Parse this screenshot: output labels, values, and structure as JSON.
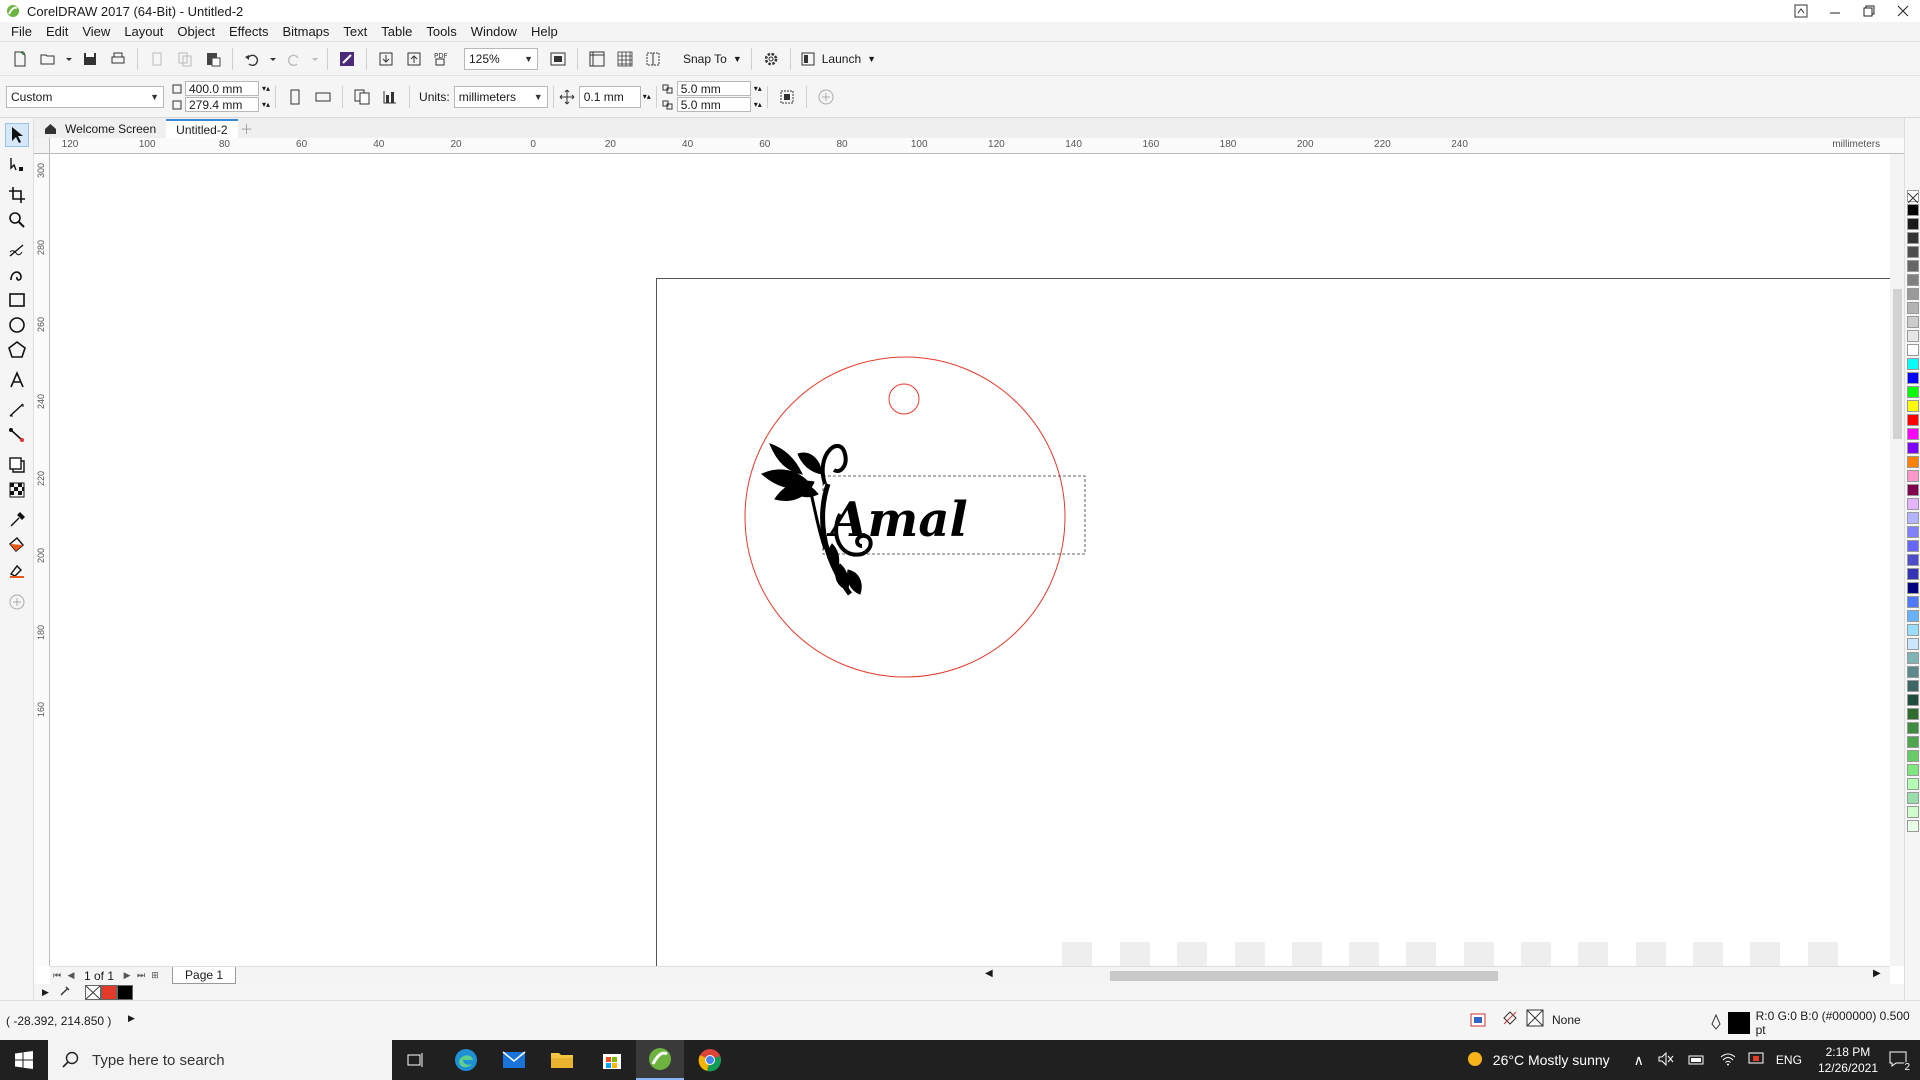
{
  "window": {
    "title": "CorelDRAW 2017 (64-Bit) - Untitled-2",
    "controls": [
      "▀",
      "–",
      "❐",
      "✕"
    ]
  },
  "menu": [
    "File",
    "Edit",
    "View",
    "Layout",
    "Object",
    "Effects",
    "Bitmaps",
    "Text",
    "Table",
    "Tools",
    "Window",
    "Help"
  ],
  "standard_toolbar": {
    "zoom": "125%",
    "snap_label": "Snap To",
    "launch_label": "Launch"
  },
  "property_bar": {
    "page_preset": "Custom",
    "width": "400.0 mm",
    "height": "279.4 mm",
    "units_label": "Units:",
    "units_value": "millimeters",
    "nudge": "0.1 mm",
    "dup_x": "5.0 mm",
    "dup_y": "5.0 mm"
  },
  "doc_tabs": [
    {
      "label": "Welcome Screen",
      "active": false
    },
    {
      "label": "Untitled-2",
      "active": true
    }
  ],
  "ruler": {
    "h_ticks": [
      "120",
      "100",
      "80",
      "60",
      "40",
      "20",
      "0",
      "20",
      "40",
      "60",
      "80",
      "100",
      "120",
      "140",
      "160",
      "180",
      "200",
      "220",
      "240"
    ],
    "v_ticks": [
      "300",
      "280",
      "260",
      "240",
      "220",
      "200",
      "180",
      "160"
    ],
    "units": "millimeters"
  },
  "drawing": {
    "text": "Amal",
    "outline_color": "#e23b2a"
  },
  "page_nav": {
    "counter": "1 of 1",
    "page_tab": "Page 1"
  },
  "status": {
    "coords": "( -28.392, 214.850 )",
    "fill_label": "None",
    "outline_info": "R:0 G:0 B:0 (#000000)  0.500 pt"
  },
  "palette_colors": [
    "#000000",
    "#1a1a1a",
    "#333333",
    "#4d4d4d",
    "#666666",
    "#808080",
    "#999999",
    "#b3b3b3",
    "#cccccc",
    "#e6e6e6",
    "#ffffff",
    "#00ffff",
    "#0000ff",
    "#00ff00",
    "#ffff00",
    "#ff0000",
    "#ff00ff",
    "#8000ff",
    "#ff8000",
    "#ff99cc",
    "#80004d",
    "#e6b3ff",
    "#b3b3ff",
    "#8080ff",
    "#6666ff",
    "#4d4dcc",
    "#3333b3",
    "#000080",
    "#4d79ff",
    "#66b3ff",
    "#99ddff",
    "#cce6ff",
    "#80b3b3",
    "#5c8a8a",
    "#3d6666",
    "#1f4d3d",
    "#2e6b2e",
    "#3d8c3d",
    "#4da64d",
    "#66cc66",
    "#80e680",
    "#b3ffb3",
    "#99ddaa",
    "#ccffcc",
    "#e6ffe6"
  ],
  "taskbar": {
    "search_placeholder": "Type here to search",
    "weather": "26°C  Mostly sunny",
    "lang": "ENG",
    "time": "2:18 PM",
    "date": "12/26/2021",
    "notif_count": "2"
  }
}
